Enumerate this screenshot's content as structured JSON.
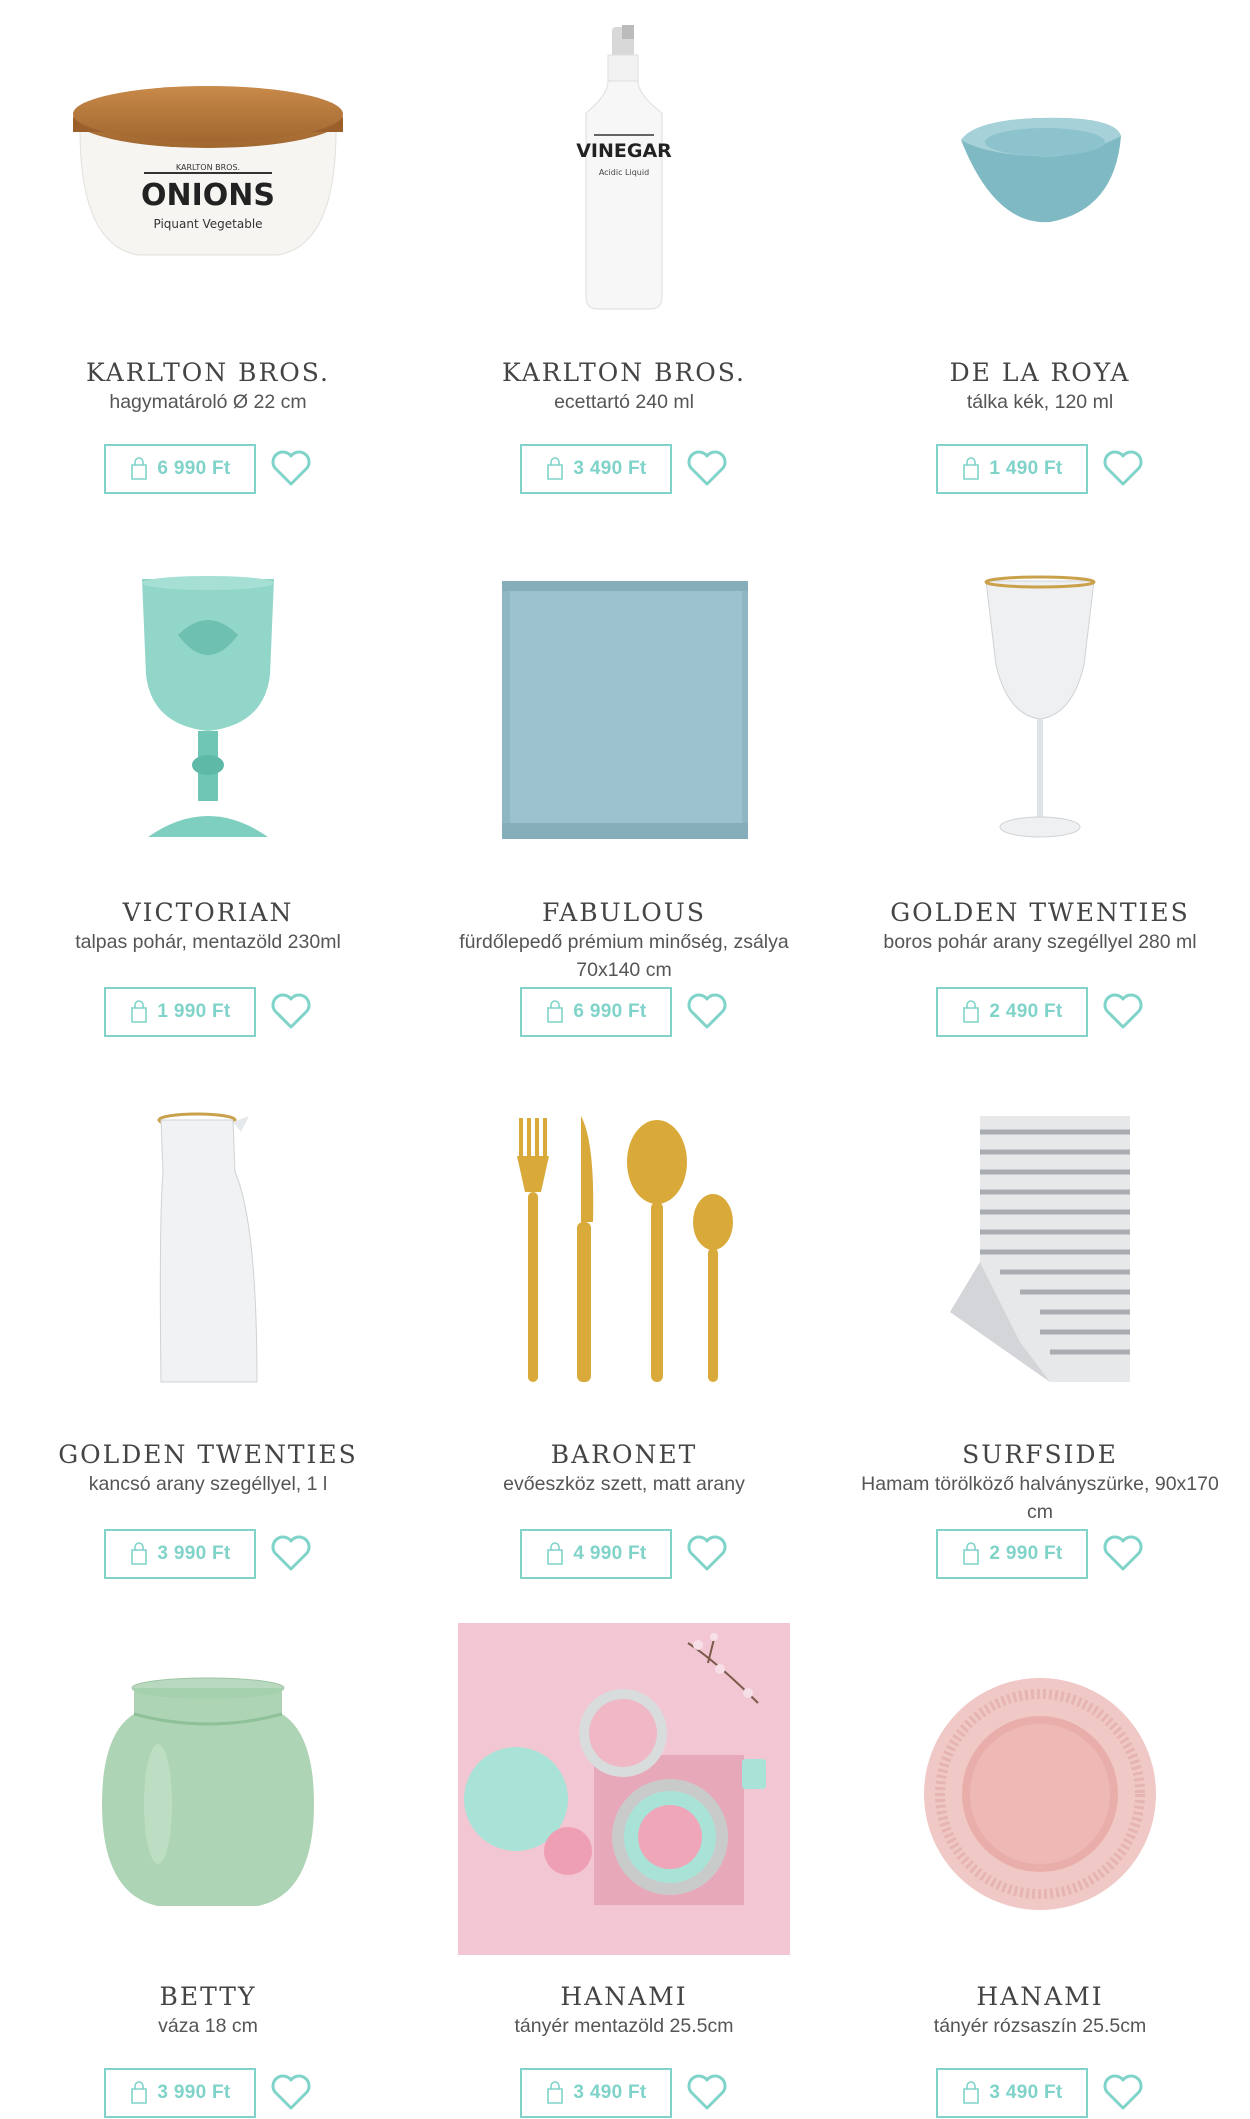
{
  "colors": {
    "accent": "#7fd3c9",
    "text": "#444444"
  },
  "products": [
    {
      "brand": "KARLTON BROS.",
      "description": "hagymatároló Ø 22 cm",
      "price": "6 990 Ft",
      "image": "onion-container",
      "image_label_title": "ONIONS",
      "image_label_sub": "Piquant Vegetable",
      "image_label_brand": "KARLTON BROS."
    },
    {
      "brand": "KARLTON BROS.",
      "description": "ecettartó 240 ml",
      "price": "3 490 Ft",
      "image": "vinegar-bottle",
      "image_label_title": "VINEGAR",
      "image_label_sub": "Acidic Liquid"
    },
    {
      "brand": "DE LA ROYA",
      "description": "tálka kék, 120 ml",
      "price": "1 490 Ft",
      "image": "blue-bowl"
    },
    {
      "brand": "VICTORIAN",
      "description": "talpas pohár, mentazöld 230ml",
      "price": "1 990 Ft",
      "image": "mint-goblet"
    },
    {
      "brand": "FABULOUS",
      "description": "fürdőlepedő prémium minőség, zsálya 70x140 cm",
      "price": "6 990 Ft",
      "image": "blue-towel"
    },
    {
      "brand": "GOLDEN TWENTIES",
      "description": "boros pohár arany szegéllyel 280 ml",
      "price": "2 490 Ft",
      "image": "wine-glass"
    },
    {
      "brand": "GOLDEN TWENTIES",
      "description": "kancsó arany szegéllyel, 1 l",
      "price": "3 990 Ft",
      "image": "glass-carafe"
    },
    {
      "brand": "BARONET",
      "description": "evőeszköz szett, matt arany",
      "price": "4 990 Ft",
      "image": "gold-cutlery"
    },
    {
      "brand": "SURFSIDE",
      "description": "Hamam törölköző halványszürke, 90x170 cm",
      "price": "2 990 Ft",
      "image": "striped-towel"
    },
    {
      "brand": "BETTY",
      "description": "váza 18 cm",
      "price": "3 990 Ft",
      "image": "green-vase"
    },
    {
      "brand": "HANAMI",
      "description": "tányér mentazöld 25.5cm",
      "price": "3 490 Ft",
      "image": "tableware-photo"
    },
    {
      "brand": "HANAMI",
      "description": "tányér rózsaszín 25.5cm",
      "price": "3 490 Ft",
      "image": "pink-plate"
    }
  ]
}
